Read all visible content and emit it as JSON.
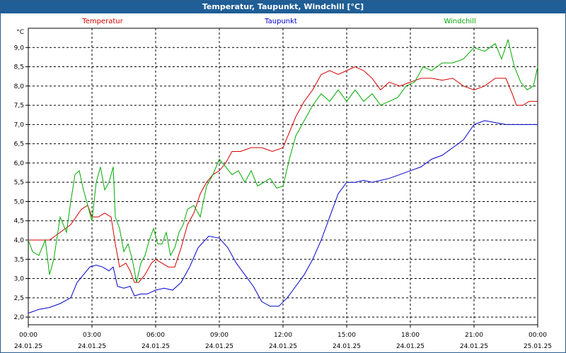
{
  "window": {
    "title": "Temperatur, Taupunkt, Windchill [°C]"
  },
  "chart_data": {
    "type": "line",
    "title": "Temperatur, Taupunkt, Windchill [°C]",
    "ylabel": "°C",
    "ylim": [
      1.8,
      9.5
    ],
    "y_ticks": [
      2.0,
      2.5,
      3.0,
      3.5,
      4.0,
      4.5,
      5.0,
      5.5,
      6.0,
      6.5,
      7.0,
      7.5,
      8.0,
      8.5,
      9.0
    ],
    "y_tick_labels": [
      "2,0",
      "2,5",
      "3,0",
      "3,5",
      "4,0",
      "4,5",
      "5,0",
      "5,5",
      "6,0",
      "6,5",
      "7,0",
      "7,5",
      "8,0",
      "8,5",
      "9,0"
    ],
    "x_range_hours": [
      0,
      24
    ],
    "x_ticks": [
      {
        "time": "00:00",
        "date": "24.01.25"
      },
      {
        "time": "03:00",
        "date": "24.01.25"
      },
      {
        "time": "06:00",
        "date": "24.01.25"
      },
      {
        "time": "09:00",
        "date": "24.01.25"
      },
      {
        "time": "12:00",
        "date": "24.01.25"
      },
      {
        "time": "15:00",
        "date": "24.01.25"
      },
      {
        "time": "18:00",
        "date": "24.01.25"
      },
      {
        "time": "21:00",
        "date": "24.01.25"
      },
      {
        "time": "00:00",
        "date": "25.01.25"
      }
    ],
    "grid": true,
    "legend_position": "top",
    "series": [
      {
        "name": "Temperatur",
        "color": "#d40000",
        "points": [
          [
            0,
            4.0
          ],
          [
            0.5,
            4.0
          ],
          [
            1.0,
            4.0
          ],
          [
            1.5,
            4.2
          ],
          [
            2.0,
            4.4
          ],
          [
            2.5,
            4.8
          ],
          [
            2.8,
            4.9
          ],
          [
            3.0,
            4.6
          ],
          [
            3.3,
            4.6
          ],
          [
            3.6,
            4.7
          ],
          [
            3.9,
            4.6
          ],
          [
            4.1,
            3.9
          ],
          [
            4.3,
            3.3
          ],
          [
            4.6,
            3.4
          ],
          [
            4.8,
            3.2
          ],
          [
            5.0,
            2.9
          ],
          [
            5.2,
            2.9
          ],
          [
            5.5,
            3.1
          ],
          [
            5.8,
            3.4
          ],
          [
            6.0,
            3.5
          ],
          [
            6.3,
            3.4
          ],
          [
            6.6,
            3.3
          ],
          [
            6.9,
            3.3
          ],
          [
            7.2,
            3.8
          ],
          [
            7.5,
            4.4
          ],
          [
            7.8,
            4.7
          ],
          [
            8.1,
            5.2
          ],
          [
            8.4,
            5.5
          ],
          [
            8.7,
            5.7
          ],
          [
            9.0,
            5.8
          ],
          [
            9.3,
            6.0
          ],
          [
            9.6,
            6.3
          ],
          [
            10.0,
            6.3
          ],
          [
            10.5,
            6.4
          ],
          [
            11.0,
            6.4
          ],
          [
            11.5,
            6.3
          ],
          [
            12.0,
            6.4
          ],
          [
            12.3,
            6.8
          ],
          [
            12.6,
            7.2
          ],
          [
            13.0,
            7.6
          ],
          [
            13.4,
            7.9
          ],
          [
            13.8,
            8.3
          ],
          [
            14.2,
            8.4
          ],
          [
            14.6,
            8.3
          ],
          [
            15.0,
            8.4
          ],
          [
            15.4,
            8.5
          ],
          [
            15.8,
            8.4
          ],
          [
            16.2,
            8.2
          ],
          [
            16.6,
            7.9
          ],
          [
            17.0,
            8.1
          ],
          [
            17.5,
            8.0
          ],
          [
            18.0,
            8.1
          ],
          [
            18.5,
            8.2
          ],
          [
            19.0,
            8.2
          ],
          [
            19.5,
            8.15
          ],
          [
            20.0,
            8.2
          ],
          [
            20.5,
            8.0
          ],
          [
            21.0,
            7.9
          ],
          [
            21.5,
            8.0
          ],
          [
            22.0,
            8.2
          ],
          [
            22.5,
            8.2
          ],
          [
            22.8,
            7.8
          ],
          [
            23.0,
            7.5
          ],
          [
            23.3,
            7.5
          ],
          [
            23.6,
            7.6
          ],
          [
            24.0,
            7.6
          ]
        ]
      },
      {
        "name": "Taupunkt",
        "color": "#0000cc",
        "points": [
          [
            0,
            2.1
          ],
          [
            0.5,
            2.2
          ],
          [
            1.0,
            2.25
          ],
          [
            1.5,
            2.35
          ],
          [
            2.0,
            2.5
          ],
          [
            2.3,
            2.9
          ],
          [
            2.6,
            3.1
          ],
          [
            2.9,
            3.3
          ],
          [
            3.2,
            3.35
          ],
          [
            3.5,
            3.3
          ],
          [
            3.8,
            3.2
          ],
          [
            4.0,
            3.3
          ],
          [
            4.2,
            2.8
          ],
          [
            4.5,
            2.75
          ],
          [
            4.8,
            2.8
          ],
          [
            5.0,
            2.55
          ],
          [
            5.3,
            2.6
          ],
          [
            5.6,
            2.6
          ],
          [
            6.0,
            2.7
          ],
          [
            6.4,
            2.75
          ],
          [
            6.8,
            2.7
          ],
          [
            7.2,
            2.9
          ],
          [
            7.6,
            3.3
          ],
          [
            8.0,
            3.8
          ],
          [
            8.5,
            4.1
          ],
          [
            9.0,
            4.05
          ],
          [
            9.4,
            3.8
          ],
          [
            9.8,
            3.4
          ],
          [
            10.2,
            3.1
          ],
          [
            10.6,
            2.8
          ],
          [
            11.0,
            2.4
          ],
          [
            11.4,
            2.28
          ],
          [
            11.8,
            2.28
          ],
          [
            12.2,
            2.5
          ],
          [
            12.6,
            2.8
          ],
          [
            13.0,
            3.1
          ],
          [
            13.4,
            3.5
          ],
          [
            13.8,
            4.0
          ],
          [
            14.2,
            4.6
          ],
          [
            14.6,
            5.2
          ],
          [
            15.0,
            5.5
          ],
          [
            15.4,
            5.5
          ],
          [
            15.8,
            5.55
          ],
          [
            16.2,
            5.5
          ],
          [
            16.6,
            5.55
          ],
          [
            17.0,
            5.6
          ],
          [
            17.5,
            5.7
          ],
          [
            18.0,
            5.8
          ],
          [
            18.5,
            5.9
          ],
          [
            19.0,
            6.1
          ],
          [
            19.5,
            6.2
          ],
          [
            20.0,
            6.4
          ],
          [
            20.5,
            6.6
          ],
          [
            21.0,
            7.0
          ],
          [
            21.5,
            7.1
          ],
          [
            22.0,
            7.05
          ],
          [
            22.5,
            7.0
          ],
          [
            23.0,
            7.0
          ],
          [
            23.5,
            7.0
          ],
          [
            24.0,
            7.0
          ]
        ]
      },
      {
        "name": "Windchill",
        "color": "#00aa00",
        "points": [
          [
            0,
            4.0
          ],
          [
            0.2,
            3.7
          ],
          [
            0.5,
            3.6
          ],
          [
            0.8,
            4.0
          ],
          [
            1.0,
            3.1
          ],
          [
            1.2,
            3.5
          ],
          [
            1.5,
            4.6
          ],
          [
            1.8,
            4.2
          ],
          [
            2.0,
            5.0
          ],
          [
            2.2,
            5.7
          ],
          [
            2.4,
            5.8
          ],
          [
            2.6,
            5.3
          ],
          [
            2.8,
            4.9
          ],
          [
            3.0,
            4.5
          ],
          [
            3.2,
            5.5
          ],
          [
            3.4,
            5.9
          ],
          [
            3.6,
            5.3
          ],
          [
            3.8,
            5.5
          ],
          [
            4.0,
            5.9
          ],
          [
            4.1,
            4.6
          ],
          [
            4.3,
            4.3
          ],
          [
            4.5,
            3.7
          ],
          [
            4.7,
            3.9
          ],
          [
            4.9,
            3.5
          ],
          [
            5.1,
            2.9
          ],
          [
            5.3,
            3.4
          ],
          [
            5.5,
            3.6
          ],
          [
            5.7,
            4.0
          ],
          [
            5.9,
            4.3
          ],
          [
            6.1,
            3.9
          ],
          [
            6.3,
            3.9
          ],
          [
            6.5,
            4.2
          ],
          [
            6.7,
            3.6
          ],
          [
            6.9,
            3.8
          ],
          [
            7.1,
            4.2
          ],
          [
            7.3,
            4.4
          ],
          [
            7.5,
            4.8
          ],
          [
            7.8,
            4.9
          ],
          [
            8.1,
            4.6
          ],
          [
            8.4,
            5.4
          ],
          [
            8.7,
            5.7
          ],
          [
            9.0,
            6.1
          ],
          [
            9.3,
            5.9
          ],
          [
            9.6,
            5.7
          ],
          [
            9.9,
            5.8
          ],
          [
            10.2,
            5.5
          ],
          [
            10.5,
            5.8
          ],
          [
            10.8,
            5.4
          ],
          [
            11.1,
            5.5
          ],
          [
            11.4,
            5.6
          ],
          [
            11.7,
            5.35
          ],
          [
            12.0,
            5.4
          ],
          [
            12.3,
            6.1
          ],
          [
            12.6,
            6.7
          ],
          [
            13.0,
            7.1
          ],
          [
            13.4,
            7.5
          ],
          [
            13.8,
            7.8
          ],
          [
            14.2,
            7.6
          ],
          [
            14.6,
            7.9
          ],
          [
            15.0,
            7.6
          ],
          [
            15.4,
            7.9
          ],
          [
            15.8,
            7.6
          ],
          [
            16.2,
            7.8
          ],
          [
            16.6,
            7.5
          ],
          [
            17.0,
            7.6
          ],
          [
            17.4,
            7.7
          ],
          [
            17.8,
            8.0
          ],
          [
            18.2,
            8.1
          ],
          [
            18.6,
            8.5
          ],
          [
            19.0,
            8.4
          ],
          [
            19.5,
            8.6
          ],
          [
            20.0,
            8.6
          ],
          [
            20.5,
            8.7
          ],
          [
            21.0,
            9.0
          ],
          [
            21.5,
            8.9
          ],
          [
            22.0,
            9.1
          ],
          [
            22.3,
            8.7
          ],
          [
            22.6,
            9.2
          ],
          [
            22.9,
            8.5
          ],
          [
            23.2,
            8.1
          ],
          [
            23.5,
            7.9
          ],
          [
            23.8,
            8.0
          ],
          [
            24.0,
            8.5
          ]
        ]
      }
    ]
  }
}
